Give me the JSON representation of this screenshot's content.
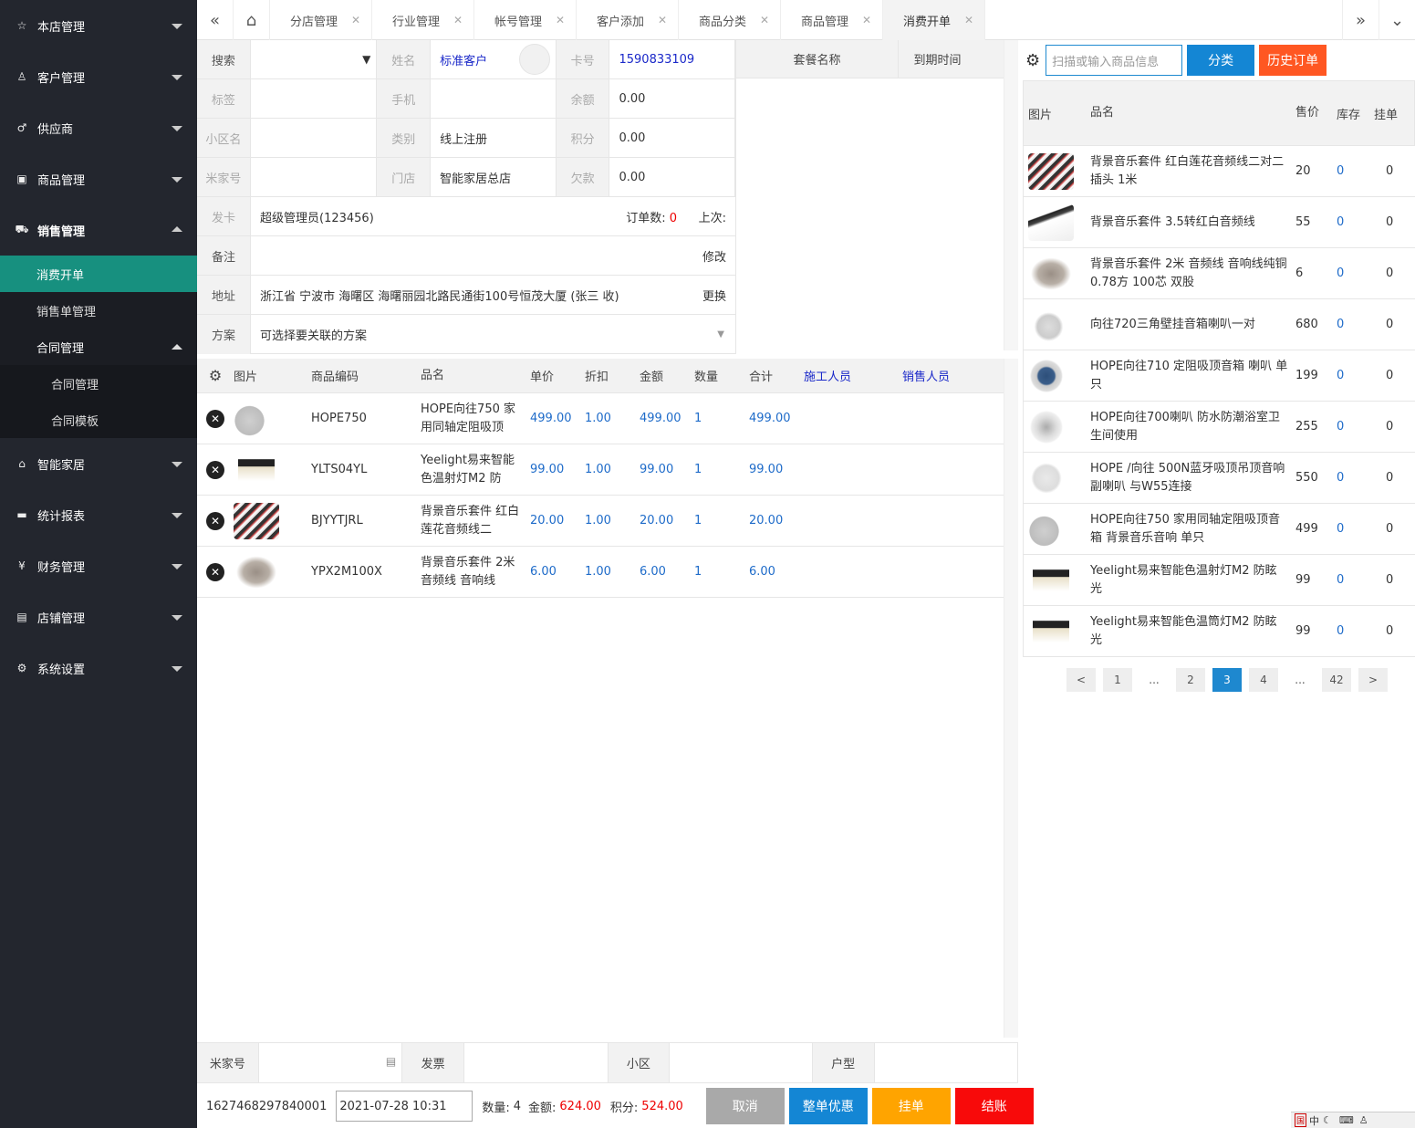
{
  "sidebar": {
    "items": [
      {
        "label": "本店管理",
        "icon": "star-icon",
        "arrow": "down"
      },
      {
        "label": "客户管理",
        "icon": "user-icon",
        "arrow": "down"
      },
      {
        "label": "供应商",
        "icon": "male-icon",
        "arrow": "down"
      },
      {
        "label": "商品管理",
        "icon": "gift-icon",
        "arrow": "down"
      },
      {
        "label": "销售管理",
        "icon": "cart-icon",
        "arrow": "up"
      }
    ],
    "sales_sub": [
      "消费开单",
      "销售单管理",
      "合同管理"
    ],
    "contract_sub": [
      "合同管理",
      "合同模板"
    ],
    "items2": [
      {
        "label": "智能家居",
        "icon": "home-icon"
      },
      {
        "label": "统计报表",
        "icon": "monitor-icon"
      },
      {
        "label": "财务管理",
        "icon": "yen-icon"
      },
      {
        "label": "店铺管理",
        "icon": "shop-icon"
      },
      {
        "label": "系统设置",
        "icon": "gear-icon"
      }
    ]
  },
  "tabs": [
    "分店管理",
    "行业管理",
    "帐号管理",
    "客户添加",
    "商品分类",
    "商品管理",
    "消费开单"
  ],
  "customer": {
    "search_label": "搜索",
    "name_label": "姓名",
    "name_value": "标准客户",
    "card_label": "卡号",
    "card_value": "1590833109",
    "tag_label": "标签",
    "phone_label": "手机",
    "balance_label": "余额",
    "balance_value": "0.00",
    "community_label": "小区名",
    "type_label": "类别",
    "type_value": "线上注册",
    "points_label": "积分",
    "points_value": "0.00",
    "mijia_label": "米家号",
    "store_label": "门店",
    "store_value": "智能家居总店",
    "debt_label": "欠款",
    "debt_value": "0.00",
    "issuer_label": "发卡",
    "issuer_value": "超级管理员(123456)",
    "orders_label": "订单数:",
    "orders_value": "0",
    "last_label": "上次:",
    "remark_label": "备注",
    "remark_action": "修改",
    "address_label": "地址",
    "address_value": "浙江省 宁波市 海曙区 海曙丽园北路民通街100号恒茂大厦 (张三 收)",
    "address_action": "更换",
    "plan_label": "方案",
    "plan_placeholder": "可选择要关联的方案"
  },
  "package": {
    "col1": "套餐名称",
    "col2": "到期时间"
  },
  "items_table": {
    "headers": [
      "图片",
      "商品编码",
      "品名",
      "单价",
      "折扣",
      "金额",
      "数量",
      "合计",
      "施工人员",
      "销售人员"
    ],
    "rows": [
      {
        "code": "HOPE750",
        "name": "HOPE向往750 家用同轴定阻吸顶",
        "price": "499.00",
        "discount": "1.00",
        "amount": "499.00",
        "qty": "1",
        "total": "499.00"
      },
      {
        "code": "YLTS04YL",
        "name": "Yeelight易来智能色温射灯M2 防",
        "price": "99.00",
        "discount": "1.00",
        "amount": "99.00",
        "qty": "1",
        "total": "99.00"
      },
      {
        "code": "BJYYTJRL",
        "name": "背景音乐套件 红白莲花音频线二",
        "price": "20.00",
        "discount": "1.00",
        "amount": "20.00",
        "qty": "1",
        "total": "20.00"
      },
      {
        "code": "YPX2M100X",
        "name": "背景音乐套件 2米 音频线 音响线",
        "price": "6.00",
        "discount": "1.00",
        "amount": "6.00",
        "qty": "1",
        "total": "6.00"
      }
    ]
  },
  "bottom_fields": [
    "米家号",
    "发票",
    "小区",
    "户型"
  ],
  "footer": {
    "order_no": "1627468297840001",
    "datetime": "2021-07-28 10:31",
    "qty_label": "数量:",
    "qty_value": "4",
    "amount_label": "金额:",
    "amount_value": "624.00",
    "points_label": "积分:",
    "points_value": "524.00",
    "cancel": "取消",
    "discount": "整单优惠",
    "hold": "挂单",
    "checkout": "结账"
  },
  "products": {
    "search_placeholder": "扫描或输入商品信息",
    "category_btn": "分类",
    "history_btn": "历史订单",
    "headers": {
      "img": "图片",
      "name": "品名",
      "price": "售价",
      "stock": "库存",
      "hold": "挂单"
    },
    "rows": [
      {
        "name": "背景音乐套件 红白莲花音频线二对二插头 1米",
        "price": "20",
        "stock": "0",
        "hold": "0"
      },
      {
        "name": "背景音乐套件 3.5转红白音频线",
        "price": "55",
        "stock": "0",
        "hold": "0"
      },
      {
        "name": "背景音乐套件 2米 音频线 音响线纯铜 0.78方 100芯 双股",
        "price": "6",
        "stock": "0",
        "hold": "0"
      },
      {
        "name": "向往720三角壁挂音箱喇叭一对",
        "price": "680",
        "stock": "0",
        "hold": "0"
      },
      {
        "name": "HOPE向往710 定阻吸顶音箱 喇叭 单只",
        "price": "199",
        "stock": "0",
        "hold": "0"
      },
      {
        "name": "HOPE向往700喇叭 防水防潮浴室卫生间使用",
        "price": "255",
        "stock": "0",
        "hold": "0"
      },
      {
        "name": "HOPE /向往 500N蓝牙吸顶吊顶音响 副喇叭 与W55连接",
        "price": "550",
        "stock": "0",
        "hold": "0"
      },
      {
        "name": "HOPE向往750 家用同轴定阻吸顶音箱 背景音乐音响 单只",
        "price": "499",
        "stock": "0",
        "hold": "0"
      },
      {
        "name": "Yeelight易来智能色温射灯M2 防眩光",
        "price": "99",
        "stock": "0",
        "hold": "0"
      },
      {
        "name": "Yeelight易来智能色温筒灯M2 防眩光",
        "price": "99",
        "stock": "0",
        "hold": "0"
      }
    ]
  },
  "pagination": [
    "<",
    "1",
    "...",
    "2",
    "3",
    "4",
    "...",
    "42",
    ">"
  ],
  "tray": "中"
}
